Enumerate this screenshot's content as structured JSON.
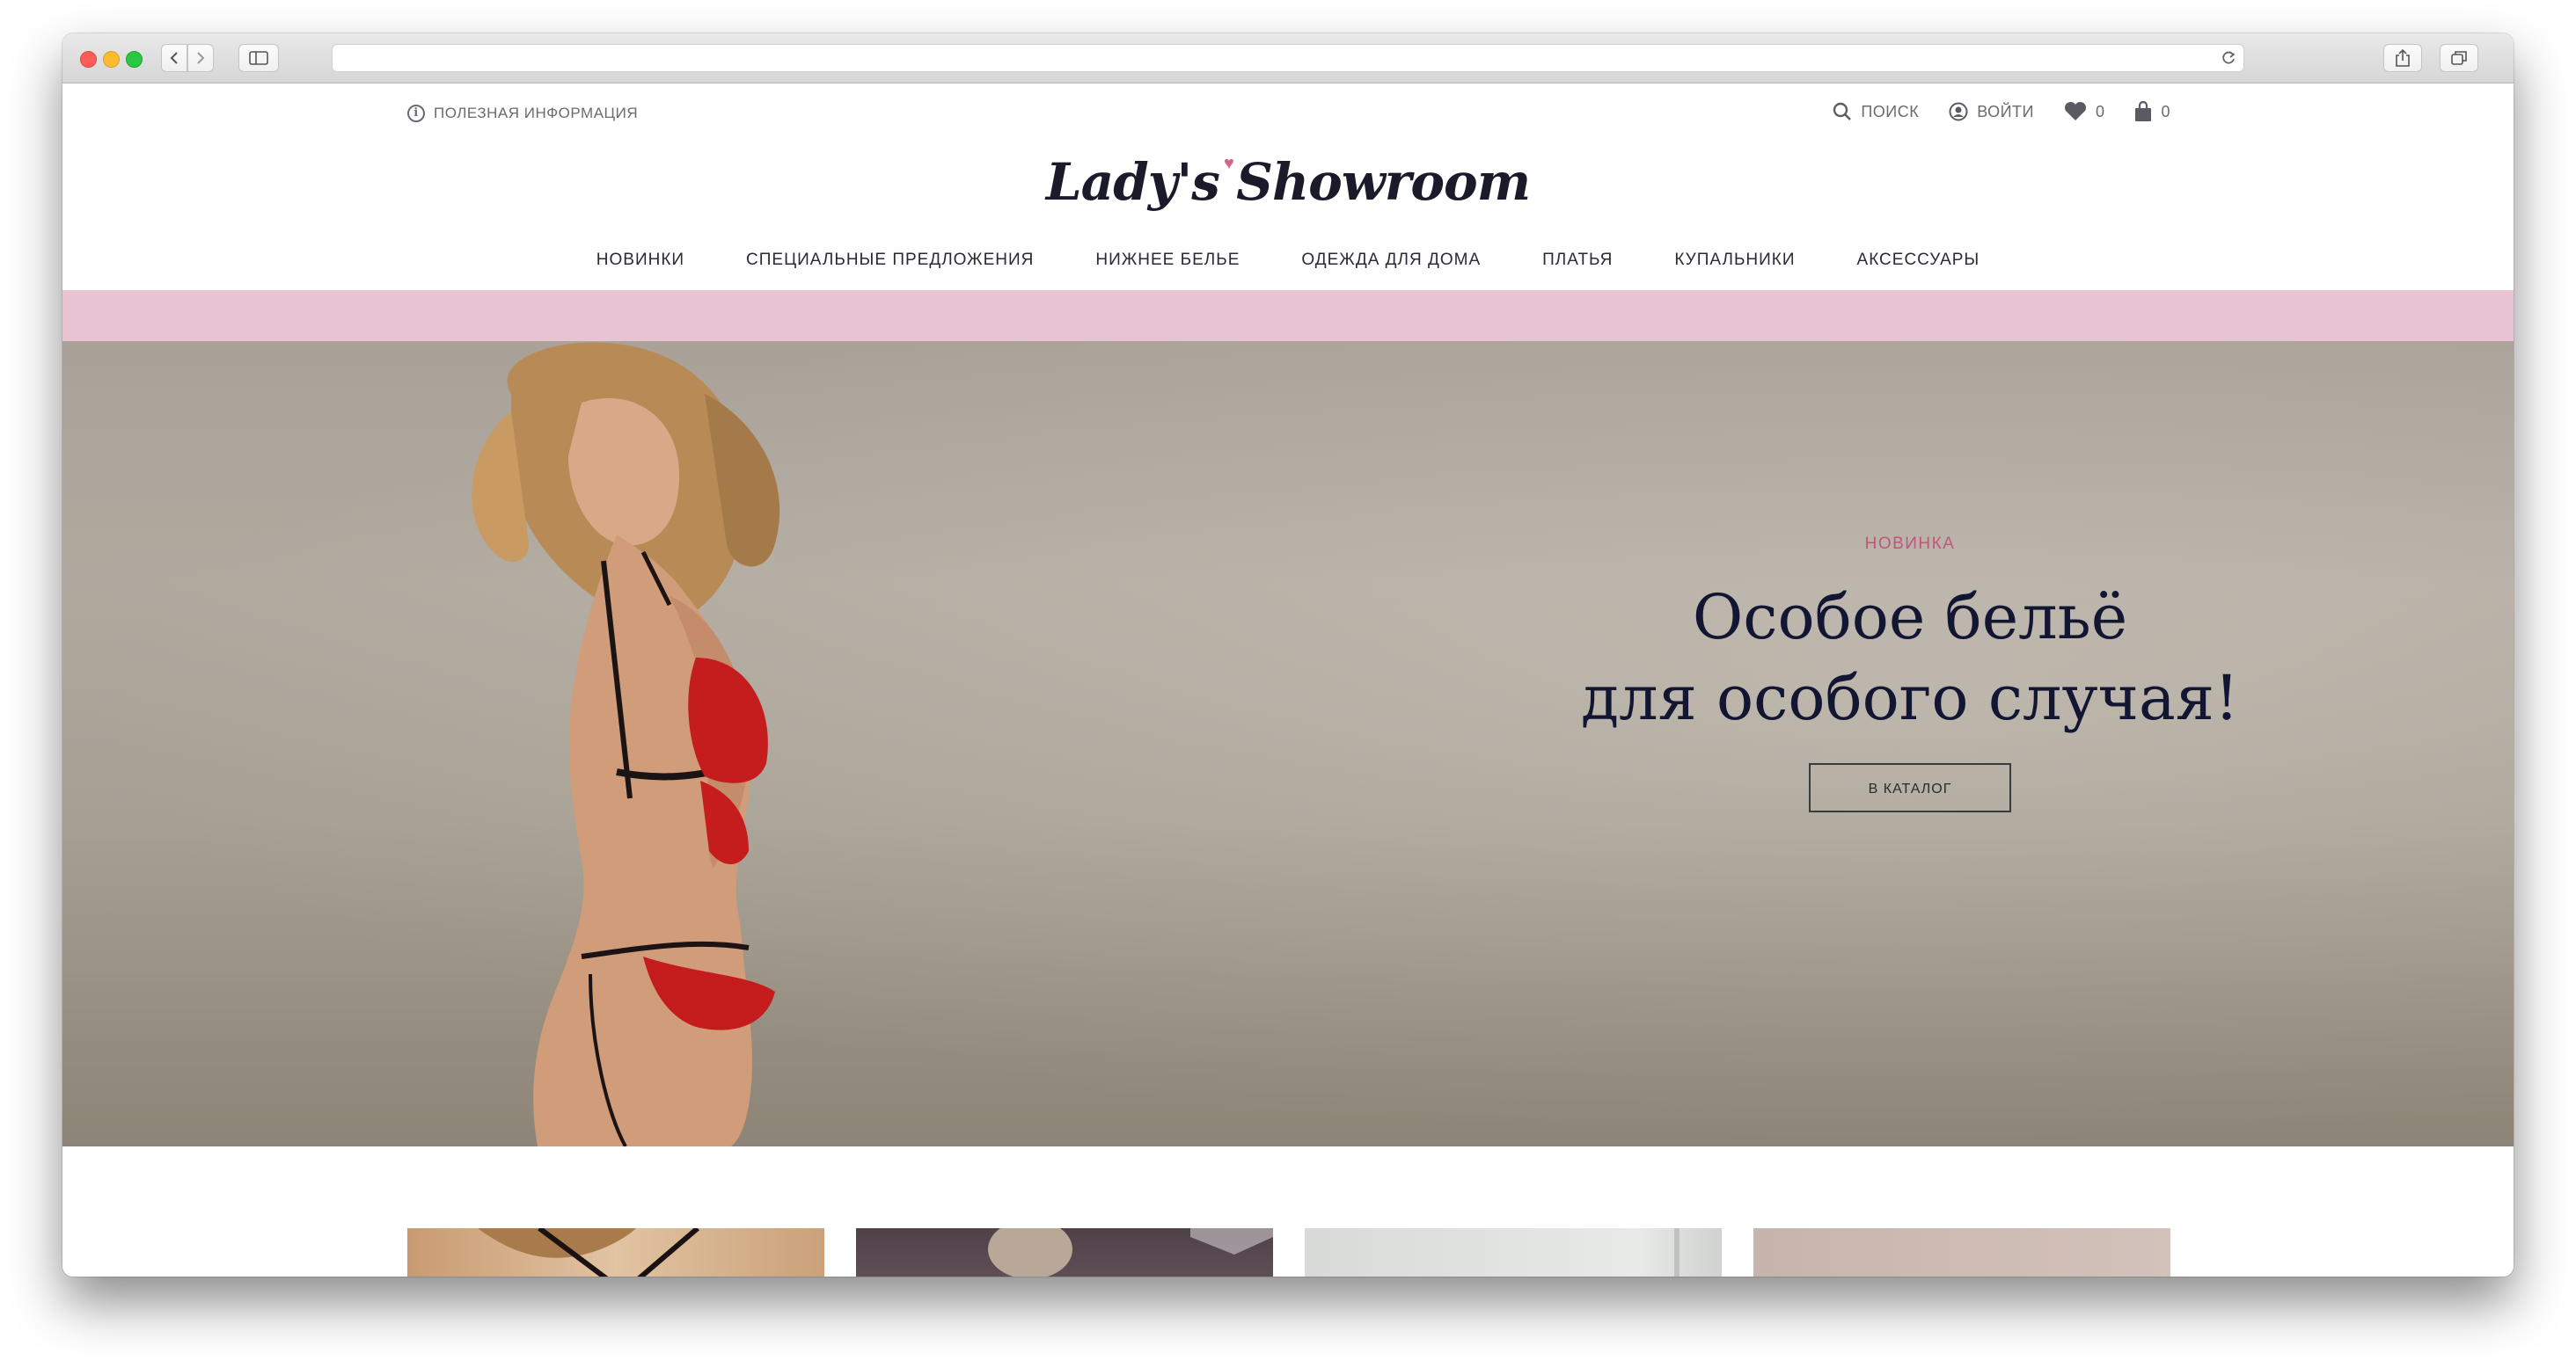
{
  "browser": {
    "address": "",
    "new_tab": "+"
  },
  "header": {
    "info_link": "ПОЛЕЗНАЯ ИНФОРМАЦИЯ",
    "logo": "Lady's Showroom",
    "search_label": "ПОИСК",
    "login_label": "ВОЙТИ",
    "wishlist_count": "0",
    "cart_count": "0"
  },
  "nav": {
    "items": [
      {
        "label": "НОВИНКИ"
      },
      {
        "label": "СПЕЦИАЛЬНЫЕ ПРЕДЛОЖЕНИЯ"
      },
      {
        "label": "НИЖНЕЕ БЕЛЬЕ"
      },
      {
        "label": "ОДЕЖДА ДЛЯ ДОМА"
      },
      {
        "label": "ПЛАТЬЯ"
      },
      {
        "label": "КУПАЛЬНИКИ"
      },
      {
        "label": "АКСЕССУАРЫ"
      }
    ]
  },
  "hero": {
    "label": "НОВИНКА",
    "title_line1": "Особое бельё",
    "title_line2": "для особого случая!",
    "button": "В КАТАЛОГ"
  },
  "colors": {
    "accent_pink": "#c0557e",
    "band_pink": "#e8c4d2",
    "title_navy": "#121633"
  }
}
